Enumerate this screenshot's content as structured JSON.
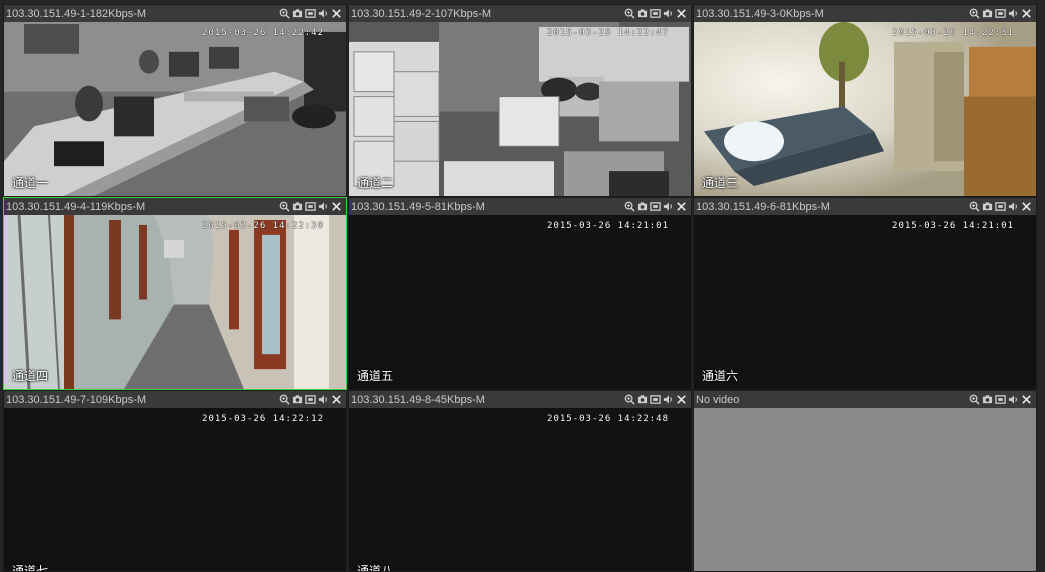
{
  "cells": [
    {
      "title": "103.30.151.49-1-182Kbps-M",
      "timestamp": "2015-03-26 14:22:42",
      "channel": "通道一"
    },
    {
      "title": "103.30.151.49-2-107Kbps-M",
      "timestamp": "2015-03-26 14:22:47",
      "channel": "通道二"
    },
    {
      "title": "103.30.151.49-3-0Kbps-M",
      "timestamp": "2015-03-26 14:22:31",
      "channel": "通道三"
    },
    {
      "title": "103.30.151.49-4-119Kbps-M",
      "timestamp": "2015-03-26 14:22:30",
      "channel": "通道四"
    },
    {
      "title": "103.30.151.49-5-81Kbps-M",
      "timestamp": "2015-03-26 14:21:01",
      "channel": "通道五"
    },
    {
      "title": "103.30.151.49-6-81Kbps-M",
      "timestamp": "2015-03-26 14:21:01",
      "channel": "通道六"
    },
    {
      "title": "103.30.151.49-7-109Kbps-M",
      "timestamp": "2015-03-26 14:22:12",
      "channel": "通道七"
    },
    {
      "title": "103.30.151.49-8-45Kbps-M",
      "timestamp": "2015-03-26 14:22:48",
      "channel": "通道八"
    },
    {
      "title": "No video"
    }
  ],
  "toolbar_icons": [
    "zoom-icon",
    "snapshot-icon",
    "record-icon",
    "audio-icon",
    "close-icon"
  ],
  "selected_cell": 4,
  "colors": {
    "selected_border": "#3fd43f",
    "titlebar": "#3a3a3a",
    "empty_video": "#121212",
    "no_video": "#8a8a8a"
  }
}
